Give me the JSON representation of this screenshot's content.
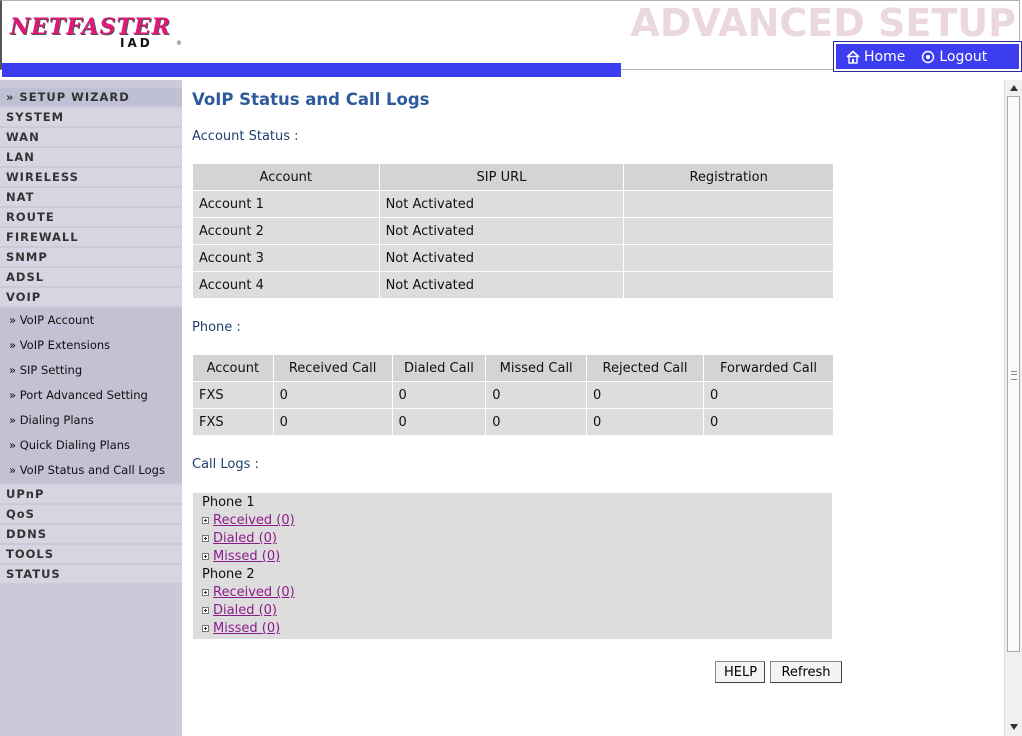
{
  "header": {
    "logo_brand": "NETFASTER",
    "logo_sub": "IAD",
    "title": "ADVANCED SETUP",
    "nav": {
      "home": "Home",
      "logout": "Logout"
    }
  },
  "sidebar": {
    "setup_wizard": "» SETUP WIZARD",
    "items_top": [
      "SYSTEM",
      "WAN",
      "LAN",
      "WIRELESS",
      "NAT",
      "ROUTE",
      "FIREWALL",
      "SNMP",
      "ADSL",
      "VOIP"
    ],
    "voip_sub": [
      "» VoIP Account",
      "» VoIP Extensions",
      "» SIP Setting",
      "» Port Advanced Setting",
      "» Dialing Plans",
      "» Quick Dialing Plans",
      "» VoIP Status and Call Logs"
    ],
    "items_bottom": [
      "UPnP",
      "QoS",
      "DDNS",
      "TOOLS",
      "STATUS"
    ]
  },
  "main": {
    "title": "VoIP Status and Call Logs",
    "account_status_label": "Account Status :",
    "account_table": {
      "headers": [
        "Account",
        "SIP URL",
        "Registration"
      ],
      "rows": [
        [
          "Account 1",
          "Not Activated",
          ""
        ],
        [
          "Account 2",
          "Not Activated",
          ""
        ],
        [
          "Account 3",
          "Not Activated",
          ""
        ],
        [
          "Account 4",
          "Not Activated",
          ""
        ]
      ]
    },
    "phone_label": "Phone :",
    "phone_table": {
      "headers": [
        "Account",
        "Received Call",
        "Dialed Call",
        "Missed Call",
        "Rejected Call",
        "Forwarded Call"
      ],
      "rows": [
        [
          "FXS",
          "0",
          "0",
          "0",
          "0",
          "0"
        ],
        [
          "FXS",
          "0",
          "0",
          "0",
          "0",
          "0"
        ]
      ]
    },
    "call_logs_label": "Call Logs :",
    "call_logs": {
      "phone1": {
        "label": "Phone 1",
        "received": "Received (0)",
        "dialed": "Dialed (0)",
        "missed": "Missed (0)"
      },
      "phone2": {
        "label": "Phone 2",
        "received": "Received (0)",
        "dialed": "Dialed (0)",
        "missed": "Missed (0)"
      }
    },
    "buttons": {
      "help": "HELP",
      "refresh": "Refresh"
    }
  },
  "colors": {
    "accent_blue": "#3c3cf0",
    "title_blue": "#2d5a9b",
    "logo_pink": "#e0187a",
    "link_purple": "#8b1d8b",
    "sidebar_bg": "#cacadb"
  }
}
